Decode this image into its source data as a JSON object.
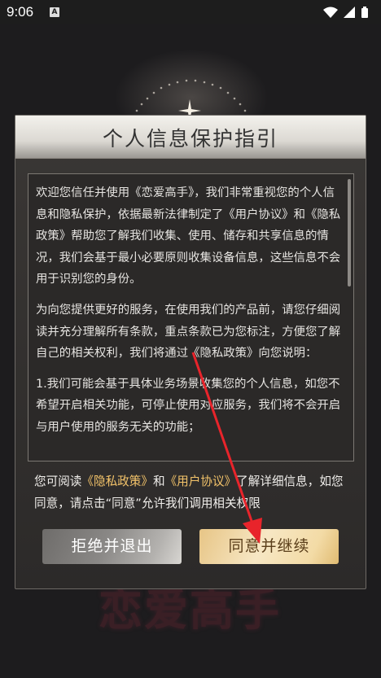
{
  "status_bar": {
    "time": "9:06",
    "notification_badge": "A",
    "icons": [
      "wifi-icon",
      "signal-icon",
      "battery-icon"
    ]
  },
  "background": {
    "logo_text": "恋爱高手"
  },
  "dialog": {
    "title": "个人信息保护指引",
    "paragraphs": [
      "欢迎您信任并使用《恋爱高手》，我们非常重视您的个人信息和隐私保护，依据最新法律制定了《用户协议》和《隐私政策》帮助您了解我们收集、使用、储存和共享信息的情况，我们会基于最小必要原则收集设备信息，这些信息不会用于识别您的身份。",
      "为向您提供更好的服务，在使用我们的产品前，请您仔细阅读并充分理解所有条款，重点条款已为您标注，方便您了解自己的相关权利，我们将通过《隐私政策》向您说明：",
      "1.我们可能会基于具体业务场景收集您的个人信息，如您不希望开启相关功能，可停止使用对应服务，我们将不会开启与用户使用的服务无关的功能；"
    ],
    "consent": {
      "prefix": "您可阅读",
      "privacy_link": "《隐私政策》",
      "and": "和",
      "agreement_link": "《用户协议》",
      "suffix": "了解详细信息，如您同意，请点击“同意”允许我们调用相关权限"
    },
    "buttons": {
      "reject": "拒绝并退出",
      "accept": "同意并继续"
    }
  },
  "colors": {
    "highlight": "#f3c36a",
    "annotation_arrow": "#e8242b",
    "accept_button": "#f3dba6"
  }
}
